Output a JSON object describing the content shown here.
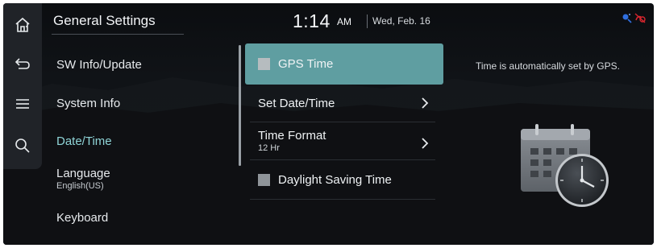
{
  "header": {
    "title": "General Settings",
    "time": "1:14",
    "ampm": "AM",
    "date": "Wed, Feb. 16"
  },
  "sidebar": {
    "icons": [
      "home-icon",
      "back-icon",
      "menu-icon",
      "search-icon"
    ]
  },
  "menu": {
    "items": [
      {
        "label": "SW Info/Update",
        "sub": ""
      },
      {
        "label": "System Info",
        "sub": ""
      },
      {
        "label": "Date/Time",
        "sub": ""
      },
      {
        "label": "Language",
        "sub": "English(US)"
      },
      {
        "label": "Keyboard",
        "sub": ""
      }
    ],
    "active_index": 2
  },
  "options": {
    "items": [
      {
        "label": "GPS Time",
        "sub": "",
        "type": "checkbox",
        "selected": true
      },
      {
        "label": "Set Date/Time",
        "sub": "",
        "type": "chevron"
      },
      {
        "label": "Time Format",
        "sub": "12 Hr",
        "type": "chevron"
      },
      {
        "label": "Daylight Saving Time",
        "sub": "",
        "type": "checkbox"
      }
    ]
  },
  "info": {
    "text": "Time is automatically set by GPS."
  },
  "colors": {
    "accent": "#5f9ea1",
    "active_text": "#8fd4d7",
    "background": "#0f1215",
    "status_blue": "#2f6fe0",
    "status_red": "#d8262e"
  }
}
